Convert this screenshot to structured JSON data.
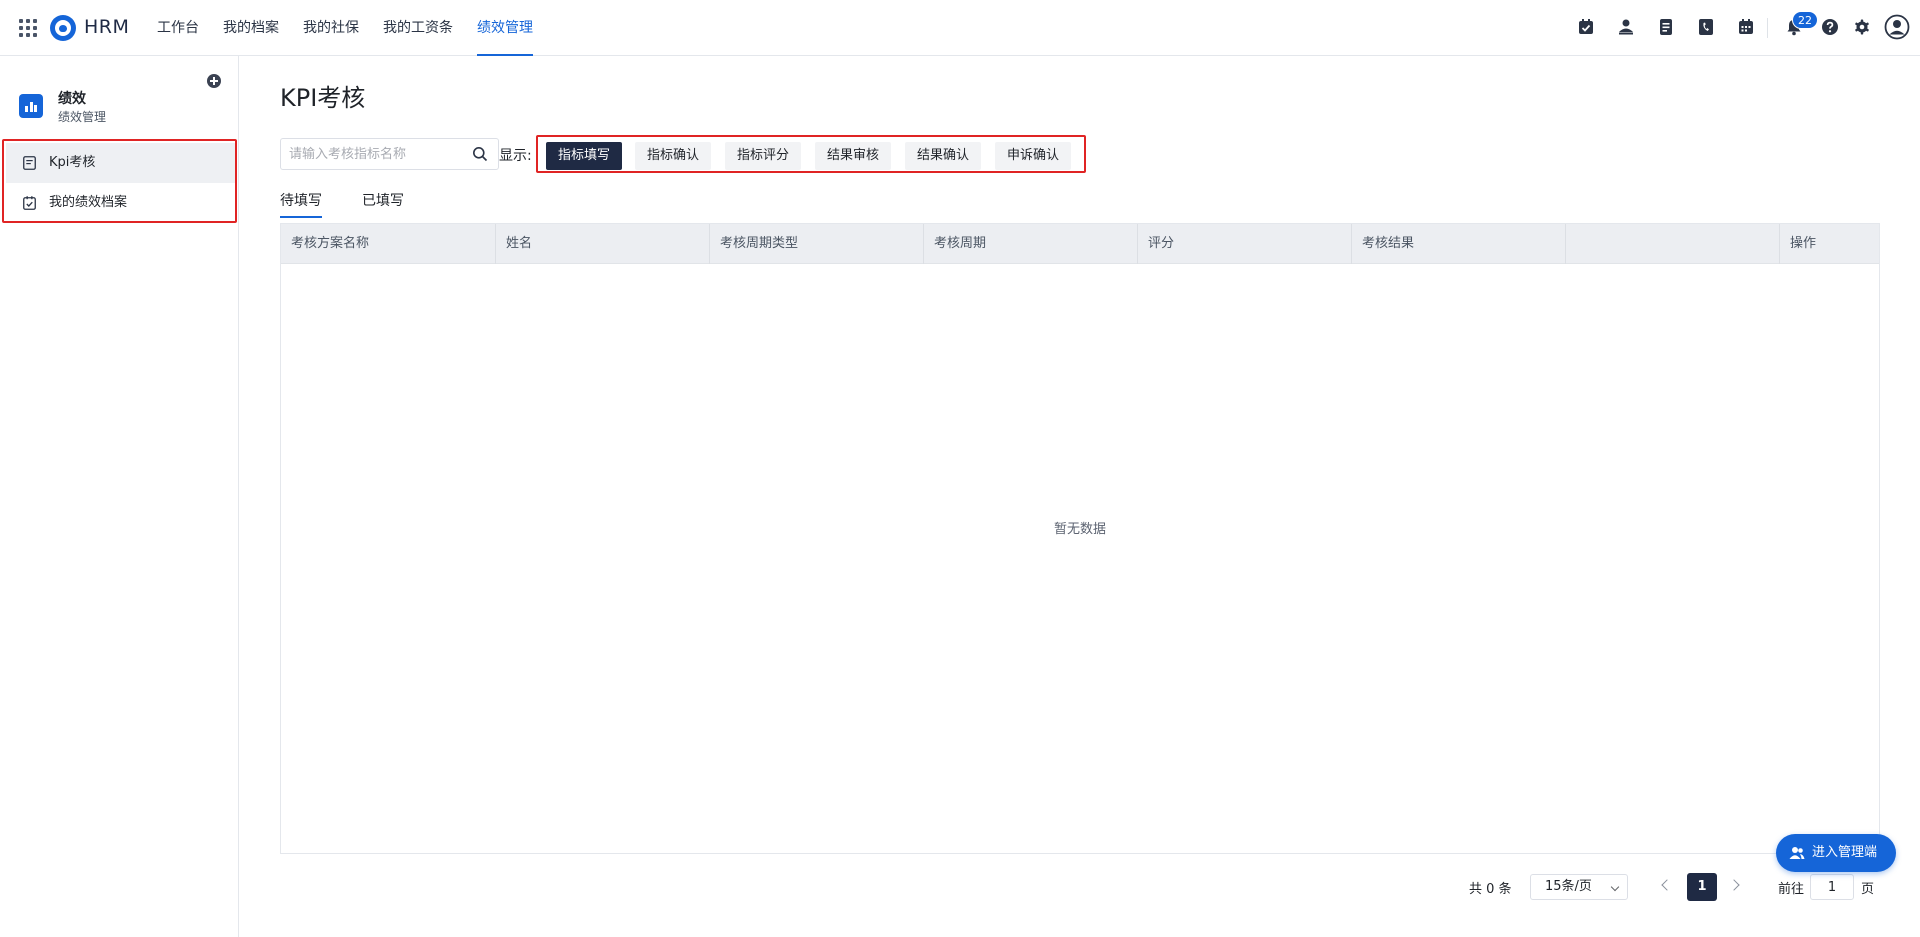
{
  "app": {
    "brand": "HRM"
  },
  "topnav": {
    "items": [
      {
        "label": "工作台"
      },
      {
        "label": "我的档案"
      },
      {
        "label": "我的社保"
      },
      {
        "label": "我的工资条"
      },
      {
        "label": "绩效管理",
        "active": true
      }
    ]
  },
  "toolbar": {
    "icons": [
      "calendar-check-icon",
      "user-stamp-icon",
      "document-icon",
      "phone-book-icon",
      "calendar-icon",
      "bell-icon",
      "help-icon",
      "gear-icon",
      "user-avatar-icon"
    ],
    "notification_count": "22"
  },
  "sidebar": {
    "title": "绩效",
    "subtitle": "绩效管理",
    "items": [
      {
        "label": "Kpi考核",
        "active": true
      },
      {
        "label": "我的绩效档案"
      }
    ]
  },
  "main": {
    "title": "KPI考核",
    "search": {
      "placeholder": "请输入考核指标名称",
      "value": ""
    },
    "show_label": "显示:",
    "filters": [
      {
        "label": "指标填写",
        "active": true
      },
      {
        "label": "指标确认"
      },
      {
        "label": "指标评分"
      },
      {
        "label": "结果审核"
      },
      {
        "label": "结果确认"
      },
      {
        "label": "申诉确认"
      }
    ],
    "tabs": [
      {
        "label": "待填写",
        "active": true
      },
      {
        "label": "已填写"
      }
    ],
    "table": {
      "columns": [
        "考核方案名称",
        "姓名",
        "考核周期类型",
        "考核周期",
        "评分",
        "考核结果",
        "",
        "操作"
      ],
      "rows": [],
      "empty_text": "暂无数据"
    },
    "pagination": {
      "total": "共 0 条",
      "page_size": "15条/页",
      "current_page": "1",
      "goto_label": "前往",
      "goto_value": "1",
      "goto_unit": "页"
    },
    "admin_button": "进入管理端"
  },
  "colors": {
    "accent": "#1565d8",
    "active_button": "#1f2a44",
    "highlight_border": "#e02424"
  }
}
